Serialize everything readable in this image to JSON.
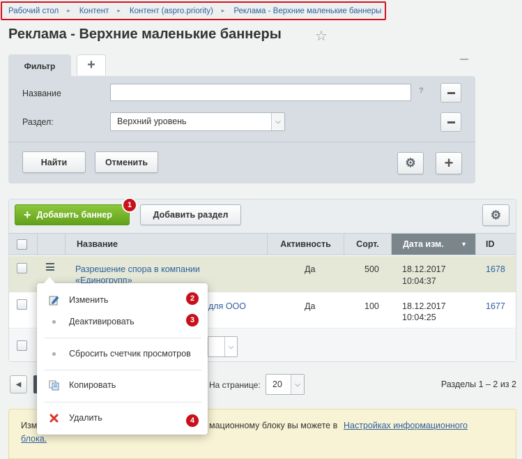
{
  "breadcrumb": [
    "Рабочий стол",
    "Контент",
    "Контент (aspro.priority)",
    "Реклама - Верхние маленькие баннеры"
  ],
  "page_title": "Реклама - Верхние маленькие баннеры",
  "filter": {
    "tab_label": "Фильтр",
    "name_label": "Название",
    "name_value": "",
    "help_mark": "?",
    "section_label": "Раздел:",
    "section_value": "Верхний уровень",
    "find_button": "Найти",
    "cancel_button": "Отменить"
  },
  "toolbar": {
    "add_banner": "Добавить баннер",
    "add_section": "Добавить раздел"
  },
  "table": {
    "columns": [
      "Название",
      "Активность",
      "Сорт.",
      "Дата изм.",
      "ID"
    ],
    "rows": [
      {
        "name_line1": "Разрешение спора в компании",
        "name_line2": "«Единогрупп»",
        "active": "Да",
        "sort": "500",
        "date": "18.12.2017",
        "time": "10:04:37",
        "id": "1678"
      },
      {
        "name_fragment": "для ООО",
        "active": "Да",
        "sort": "100",
        "date": "18.12.2017",
        "time": "10:04:25",
        "id": "1677"
      }
    ]
  },
  "pagination": {
    "per_page_label": "На странице:",
    "per_page_value": "20",
    "sections_count": "Разделы 1 – 2 из 2"
  },
  "notice": {
    "text_start": "Изм",
    "text_mid": "мационному блоку вы можете в",
    "link_part1": "Настройках информационного",
    "link_part2": "блока."
  },
  "context_menu": {
    "items": [
      {
        "label": "Изменить",
        "icon": "edit-icon"
      },
      {
        "label": "Деактивировать",
        "icon": "dot-icon"
      },
      {
        "label": "Сбросить счетчик просмотров",
        "icon": "dot-icon"
      },
      {
        "label": "Копировать",
        "icon": "copy-icon"
      },
      {
        "label": "Удалить",
        "icon": "delete-icon"
      }
    ]
  },
  "badges": [
    "1",
    "2",
    "3",
    "4"
  ],
  "colors": {
    "highlight_border": "#d0111e",
    "badge": "#c8101a",
    "add_button": "#6aa722",
    "link": "#2e5f9c",
    "selected_row": "#e5e8d7",
    "sorted_column": "#7b858c"
  }
}
